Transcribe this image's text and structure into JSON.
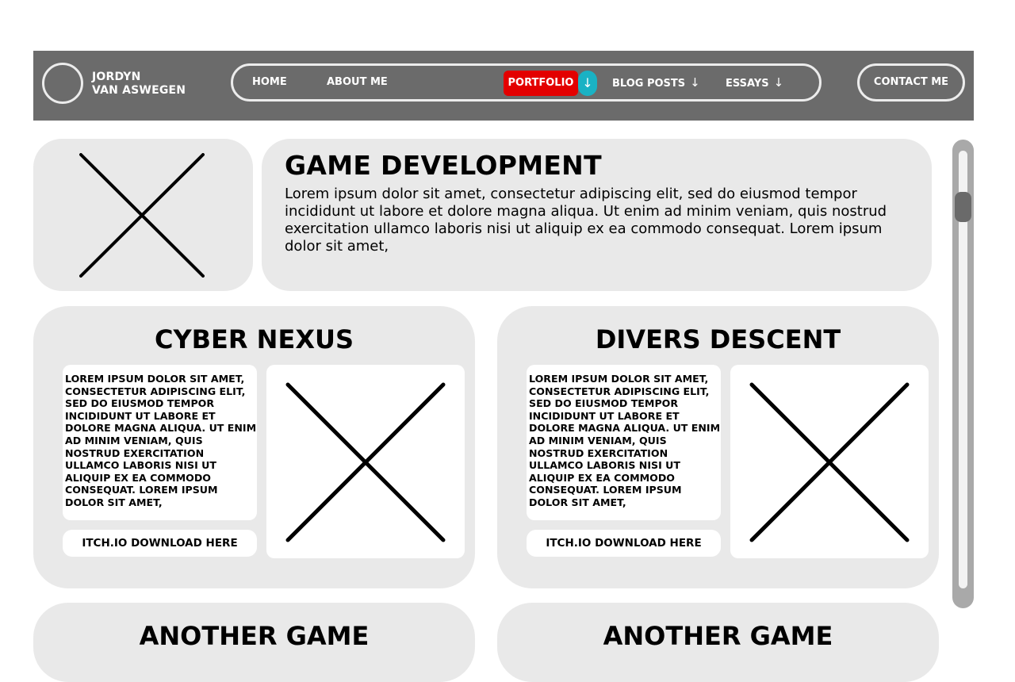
{
  "brand": {
    "line1": "JORDYN",
    "line2": "VAN ASWEGEN"
  },
  "nav": {
    "home": "HOME",
    "about": "ABOUT ME",
    "portfolio": "PORTFOLIO",
    "portfolio_arrow": "↓",
    "blog": "BLOG POSTS",
    "blog_arrow": "↓",
    "essays": "ESSAYS",
    "essays_arrow": "↓",
    "contact": "CONTACT ME",
    "active_color": "#e30000",
    "arrow_accent_color": "#1ab2c4"
  },
  "hero": {
    "title": "GAME DEVELOPMENT",
    "description": "Lorem ipsum dolor sit amet, consectetur adipiscing elit, sed do eiusmod tempor incididunt ut labore et dolore magna aliqua. Ut enim ad minim veniam, quis nostrud exercitation ullamco laboris nisi ut aliquip ex ea commodo consequat. Lorem ipsum dolor sit amet,",
    "image_icon": "placeholder-x-icon"
  },
  "games": [
    {
      "title": "CYBER NEXUS",
      "description": "LOREM IPSUM DOLOR SIT AMET, CONSECTETUR ADIPISCING ELIT, SED DO EIUSMOD TEMPOR INCIDIDUNT UT LABORE ET DOLORE MAGNA ALIQUA. UT ENIM AD MINIM VENIAM, QUIS NOSTRUD EXERCITATION ULLAMCO LABORIS NISI UT ALIQUIP EX EA COMMODO CONSEQUAT. LOREM IPSUM DOLOR SIT AMET,",
      "download_label": "ITCH.IO DOWNLOAD HERE",
      "image_icon": "placeholder-x-icon"
    },
    {
      "title": "DIVERS DESCENT",
      "description": "LOREM IPSUM DOLOR SIT AMET, CONSECTETUR ADIPISCING ELIT, SED DO EIUSMOD TEMPOR INCIDIDUNT UT LABORE ET DOLORE MAGNA ALIQUA. UT ENIM AD MINIM VENIAM, QUIS NOSTRUD EXERCITATION ULLAMCO LABORIS NISI UT ALIQUIP EX EA COMMODO CONSEQUAT. LOREM IPSUM DOLOR SIT AMET,",
      "download_label": "ITCH.IO DOWNLOAD HERE",
      "image_icon": "placeholder-x-icon"
    }
  ],
  "more_games": [
    {
      "title": "ANOTHER GAME"
    },
    {
      "title": "ANOTHER GAME"
    }
  ],
  "colors": {
    "navbar_bg": "#6b6b6b",
    "card_bg": "#e9e9e9",
    "scrollbar_bg": "#a9a9a9"
  }
}
